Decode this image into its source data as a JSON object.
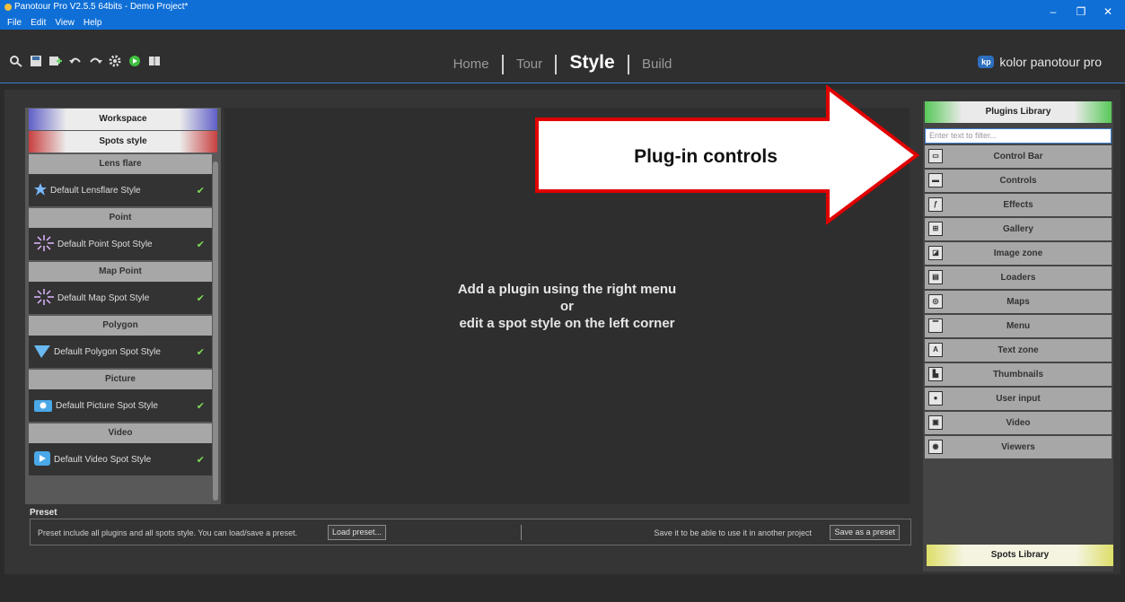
{
  "window": {
    "title": "Panotour Pro V2.5.5 64bits - Demo Project*",
    "menu": [
      "File",
      "Edit",
      "View",
      "Help"
    ],
    "controls": [
      "–",
      "❐",
      "✕"
    ]
  },
  "toolbar": {
    "icons": [
      "find-icon",
      "save-icon",
      "publish-icon",
      "undo-icon",
      "redo-icon",
      "settings-icon",
      "play-icon",
      "book-icon"
    ]
  },
  "nav": {
    "tabs": [
      "Home",
      "Tour",
      "Style",
      "Build"
    ],
    "active": "Style"
  },
  "brand": {
    "logo": "kp",
    "name": "kolor panotour pro"
  },
  "left_panel": {
    "workspace": "Workspace",
    "spots_style": "Spots style",
    "sections": [
      {
        "title": "Lens flare",
        "item": "Default Lensflare Style",
        "icon": "star-icon"
      },
      {
        "title": "Point",
        "item": "Default Point Spot Style",
        "icon": "point-icon"
      },
      {
        "title": "Map Point",
        "item": "Default Map Spot Style",
        "icon": "map-point-icon"
      },
      {
        "title": "Polygon",
        "item": "Default Polygon Spot Style",
        "icon": "polygon-icon"
      },
      {
        "title": "Picture",
        "item": "Default Picture Spot Style",
        "icon": "camera-icon"
      },
      {
        "title": "Video",
        "item": "Default Video Spot Style",
        "icon": "video-icon"
      }
    ],
    "check": "✔"
  },
  "center": {
    "line1": "Add a plugin using the right menu",
    "line2": "or",
    "line3": "edit a spot style on the left corner"
  },
  "preset": {
    "label": "Preset",
    "left_text": "Preset include all plugins and all spots style. You can load/save a preset.",
    "load_button": "Load preset...",
    "right_text": "Save it to be able to use it in another project",
    "save_button": "Save as a preset"
  },
  "right_panel": {
    "header": "Plugins Library",
    "filter_placeholder": "Enter text to filter...",
    "items": [
      {
        "label": "Control Bar",
        "icon": "control-bar-icon"
      },
      {
        "label": "Controls",
        "icon": "controls-icon"
      },
      {
        "label": "Effects",
        "icon": "effects-icon"
      },
      {
        "label": "Gallery",
        "icon": "gallery-icon"
      },
      {
        "label": "Image zone",
        "icon": "image-zone-icon"
      },
      {
        "label": "Loaders",
        "icon": "loaders-icon"
      },
      {
        "label": "Maps",
        "icon": "maps-icon"
      },
      {
        "label": "Menu",
        "icon": "menu-icon"
      },
      {
        "label": "Text zone",
        "icon": "text-zone-icon"
      },
      {
        "label": "Thumbnails",
        "icon": "thumbnails-icon"
      },
      {
        "label": "User input",
        "icon": "user-input-icon"
      },
      {
        "label": "Video",
        "icon": "video-plugin-icon"
      },
      {
        "label": "Viewers",
        "icon": "viewers-icon"
      }
    ],
    "footer": "Spots Library"
  },
  "annotation": {
    "text": "Plug-in controls"
  },
  "colors": {
    "titlebar": "#0f6fd6",
    "accent_red": "#e00000",
    "check_green": "#7ed957"
  }
}
